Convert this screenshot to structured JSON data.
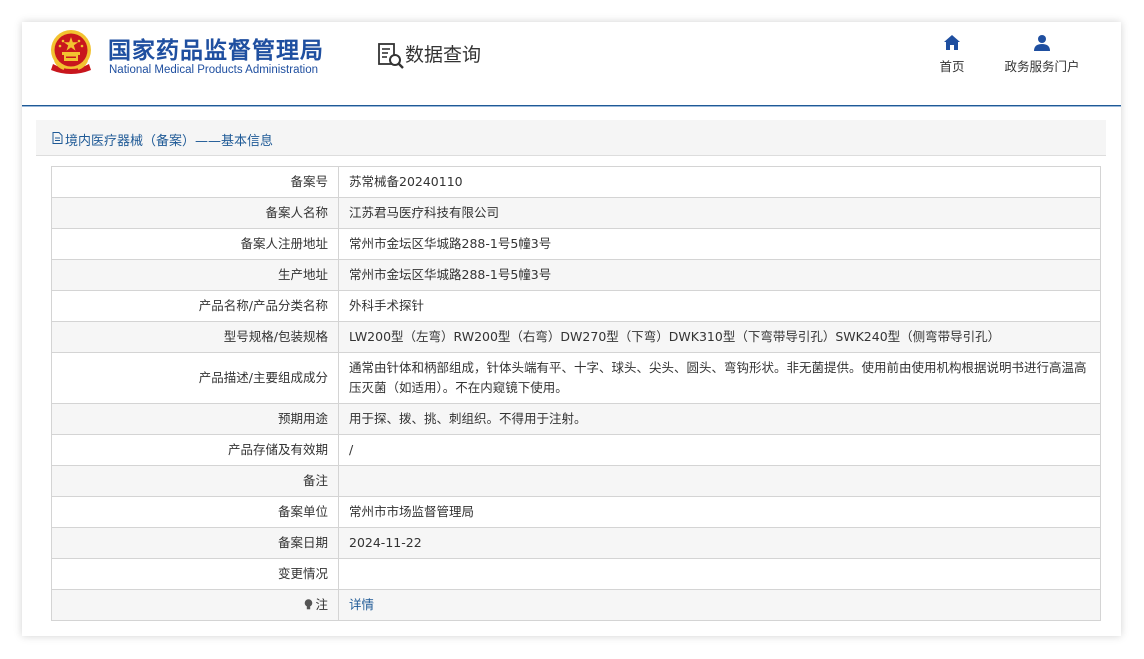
{
  "header": {
    "title_cn": "国家药品监督管理局",
    "title_en": "National Medical Products Administration",
    "query_label": "数据查询",
    "nav": [
      {
        "label": "首页",
        "icon": "home-icon"
      },
      {
        "label": "政务服务门户",
        "icon": "user-icon"
      }
    ]
  },
  "panel": {
    "title": "境内医疗器械（备案）——基本信息"
  },
  "rows": [
    {
      "key": "备案号",
      "value": "苏常械备20240110"
    },
    {
      "key": "备案人名称",
      "value": "江苏君马医疗科技有限公司"
    },
    {
      "key": "备案人注册地址",
      "value": "常州市金坛区华城路288-1号5幢3号"
    },
    {
      "key": "生产地址",
      "value": "常州市金坛区华城路288-1号5幢3号"
    },
    {
      "key": "产品名称/产品分类名称",
      "value": "外科手术探针"
    },
    {
      "key": "型号规格/包装规格",
      "value": "LW200型（左弯）RW200型（右弯）DW270型（下弯）DWK310型（下弯带导引孔）SWK240型（侧弯带导引孔）"
    },
    {
      "key": "产品描述/主要组成成分",
      "value": "通常由针体和柄部组成，针体头端有平、十字、球头、尖头、圆头、弯钩形状。非无菌提供。使用前由使用机构根据说明书进行高温高压灭菌（如适用）。不在内窥镜下使用。"
    },
    {
      "key": "预期用途",
      "value": "用于探、拨、挑、刺组织。不得用于注射。"
    },
    {
      "key": "产品存储及有效期",
      "value": "/"
    },
    {
      "key": "备注",
      "value": ""
    },
    {
      "key": "备案单位",
      "value": "常州市市场监督管理局"
    },
    {
      "key": "备案日期",
      "value": "2024-11-22"
    },
    {
      "key": "变更情况",
      "value": ""
    },
    {
      "key": "注",
      "value": "详情"
    }
  ],
  "colors": {
    "brand_blue": "#1f4fa0",
    "link_blue": "#1f5a96",
    "emblem_red": "#c8161d",
    "emblem_gold": "#f2c230"
  }
}
